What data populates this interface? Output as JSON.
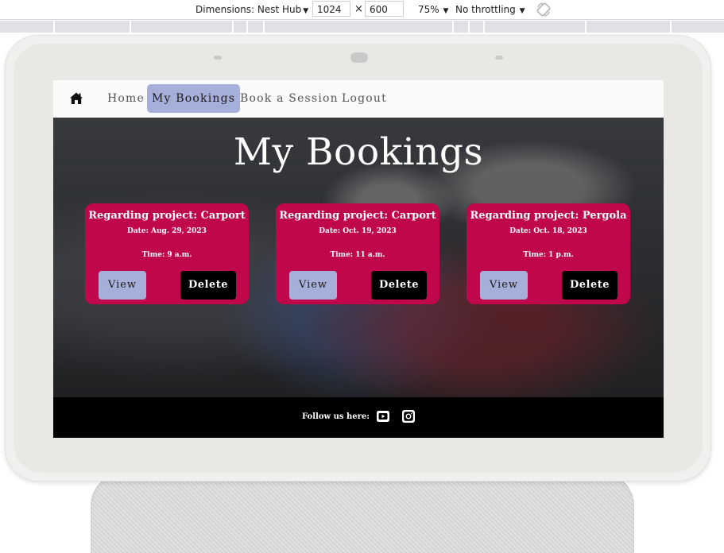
{
  "devtools": {
    "dimensions_label": "Dimensions: Nest Hub",
    "width": "1024",
    "height": "600",
    "times": "×",
    "zoom": "75%",
    "throttling": "No throttling"
  },
  "nav": {
    "home_icon": "home-icon",
    "links": [
      "Home",
      "My Bookings",
      "Book a Session",
      "Logout"
    ],
    "active": "My Bookings"
  },
  "page": {
    "title": "My Bookings"
  },
  "bookings": [
    {
      "project": "Regarding project: Carport",
      "date": "Date: Aug. 29, 2023",
      "time": "Time: 9 a.m.",
      "view_label": "View",
      "delete_label": "Delete"
    },
    {
      "project": "Regarding project: Carport",
      "date": "Date: Oct. 19, 2023",
      "time": "Time: 11 a.m.",
      "view_label": "View",
      "delete_label": "Delete"
    },
    {
      "project": "Regarding project: Pergola",
      "date": "Date: Oct. 18, 2023",
      "time": "Time: 1 p.m.",
      "view_label": "View",
      "delete_label": "Delete"
    }
  ],
  "footer": {
    "follow_text": "Follow us here:",
    "social": [
      "youtube-icon",
      "instagram-icon"
    ]
  },
  "colors": {
    "card": "#c0074c",
    "accent": "#a6afd9",
    "delete": "#000000",
    "footer": "#000000"
  }
}
